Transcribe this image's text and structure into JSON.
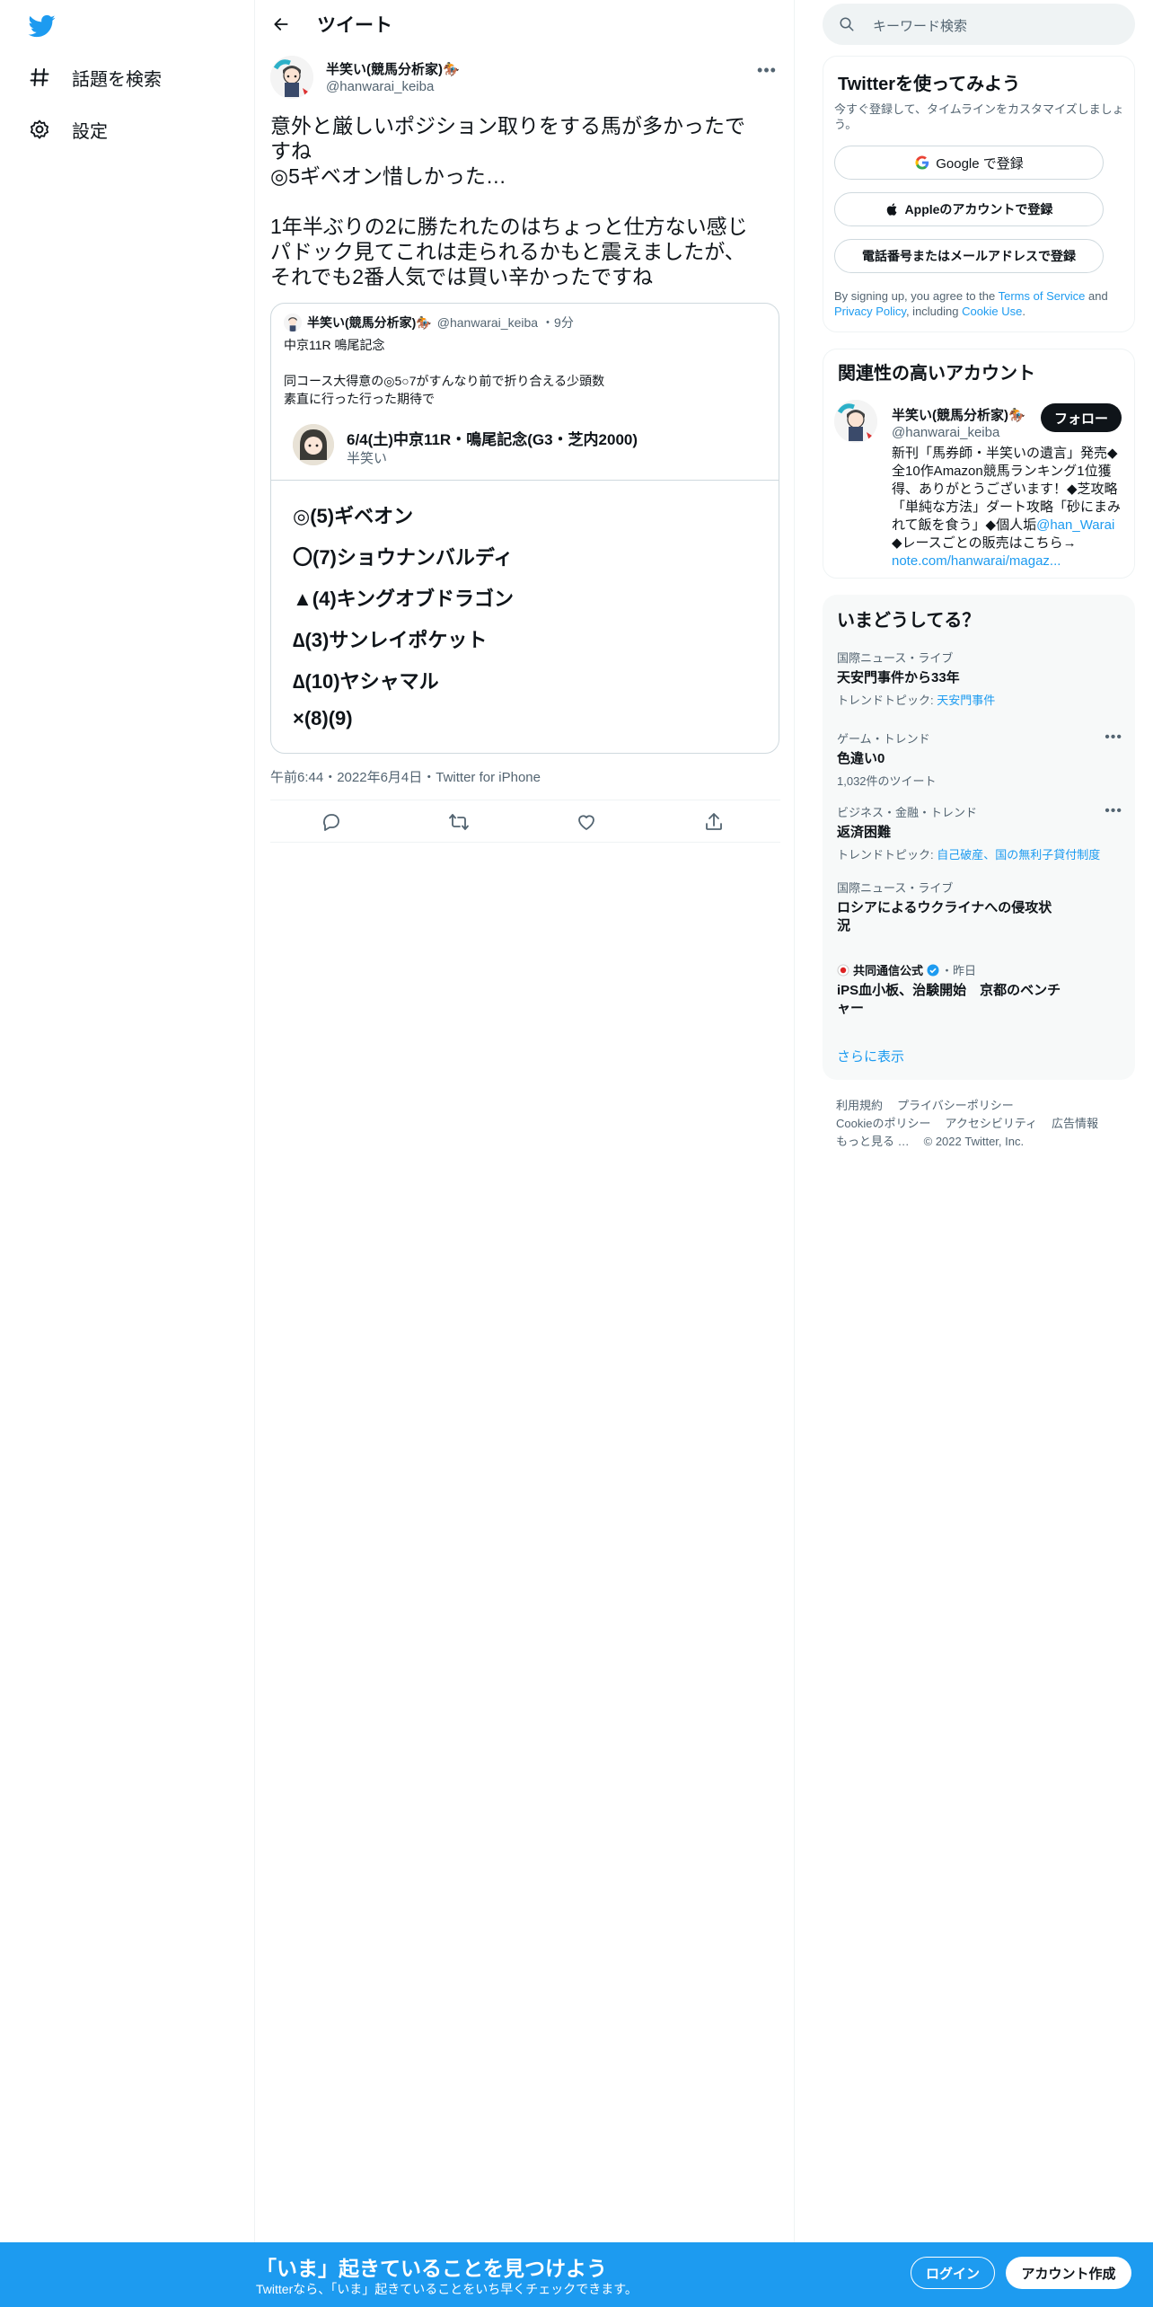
{
  "nav": {
    "logo": "twitter-bird-icon",
    "items": [
      {
        "label": "話題を検索",
        "icon": "hashtag-icon"
      },
      {
        "label": "設定",
        "icon": "gear-icon"
      }
    ]
  },
  "header": {
    "title": "ツイート"
  },
  "tweet": {
    "author_name": "半笑い(競馬分析家)🏇",
    "author_handle": "@hanwarai_keiba",
    "text": "意外と厳しいポジション取りをする馬が多かったで\nすね\n◎5ギベオン惜しかった…\n\n1年半ぶりの2に勝たれたのはちょっと仕方ない感じ\nパドック見てこれは走られるかもと震えましたが、\nそれでも2番人気では買い辛かったですね",
    "timestamp": "午前6:44・2022年6月4日・Twitter for iPhone"
  },
  "quote": {
    "author_name": "半笑い(競馬分析家)🏇",
    "author_handle": "@hanwarai_keiba",
    "time": "・9分",
    "text": "中京11R 鳴尾記念\n\n同コース大得意の◎5○7がすんなり前で折り合える少頭数\n素直に行った行った期待で",
    "card_title": "6/4(土)中京11R・鳴尾記念(G3・芝内2000)",
    "card_sub": "半笑い",
    "picks": [
      "◎(5)ギベオン",
      "〇(7)ショウナンバルディ",
      "▲(4)キングオブドラゴン",
      "∆(3)サンレイポケット",
      "∆(10)ヤシャマル",
      "×(8)(9)"
    ]
  },
  "search": {
    "placeholder": "キーワード検索"
  },
  "signup_box": {
    "title": "Twitterを使ってみよう",
    "subtitle": "今すぐ登録して、タイムラインをカスタマイズしましょう。",
    "google": "Google で登録",
    "apple": "Appleのアカウントで登録",
    "phone": "電話番号またはメールアドレスで登録",
    "legal_1": "By signing up, you agree to the ",
    "terms": "Terms of Service",
    "legal_2": " and ",
    "privacy": "Privacy Policy",
    "legal_3": ", including ",
    "cookie": "Cookie Use",
    "legal_4": "."
  },
  "related": {
    "title": "関連性の高いアカウント",
    "name": "半笑い(競馬分析家)🏇",
    "handle": "@hanwarai_keiba",
    "follow": "フォロー",
    "bio": "新刊「馬券師・半笑いの遺言」発売◆全10作Amazon競馬ランキング1位獲得、ありがとうございます！◆芝攻略「単純な方法」ダート攻略「砂にまみれて飯を食う」◆個人垢",
    "bio_link": "@han_Warai",
    "bio_2": "◆レースごとの販売はこちら→",
    "bio_link2": "note.com/hanwarai/magaz..."
  },
  "trends": {
    "title": "いまどうしてる？",
    "items": [
      {
        "meta": "国際ニュース・ライブ",
        "topic": "天安門事件から33年",
        "extra_label": "トレンドトピック: ",
        "extra_link": "天安門事件"
      },
      {
        "meta": "ゲーム・トレンド",
        "topic": "色違い0",
        "extra_label": "1,032件のツイート",
        "extra_link": ""
      },
      {
        "meta": "ビジネス・金融・トレンド",
        "topic": "返済困難",
        "extra_label": "トレンドトピック: ",
        "extra_link": "自己破産、国の無利子貸付制度"
      },
      {
        "meta": "国際ニュース・ライブ",
        "topic": "ロシアによるウクライナへの侵攻状況",
        "extra_label": "",
        "extra_link": ""
      },
      {
        "meta_name": "共同通信公式",
        "meta_time": "・昨日",
        "topic": "iPS血小板、治験開始　京都のベンチャー"
      }
    ],
    "show_more": "さらに表示"
  },
  "footer": {
    "row1": [
      "利用規約",
      "プライバシーポリシー"
    ],
    "row2": [
      "Cookieのポリシー",
      "アクセシビリティ",
      "広告情報"
    ],
    "row3": [
      "もっと見る …",
      "© 2022 Twitter, Inc."
    ]
  },
  "bottom": {
    "big": "「いま」起きていることを見つけよう",
    "small": "Twitterなら、「いま」起きていることをいち早くチェックできます。",
    "login": "ログイン",
    "signup": "アカウント作成"
  },
  "colors": {
    "accent": "#1d9bf0",
    "text": "#0f1419",
    "muted": "#536471"
  }
}
